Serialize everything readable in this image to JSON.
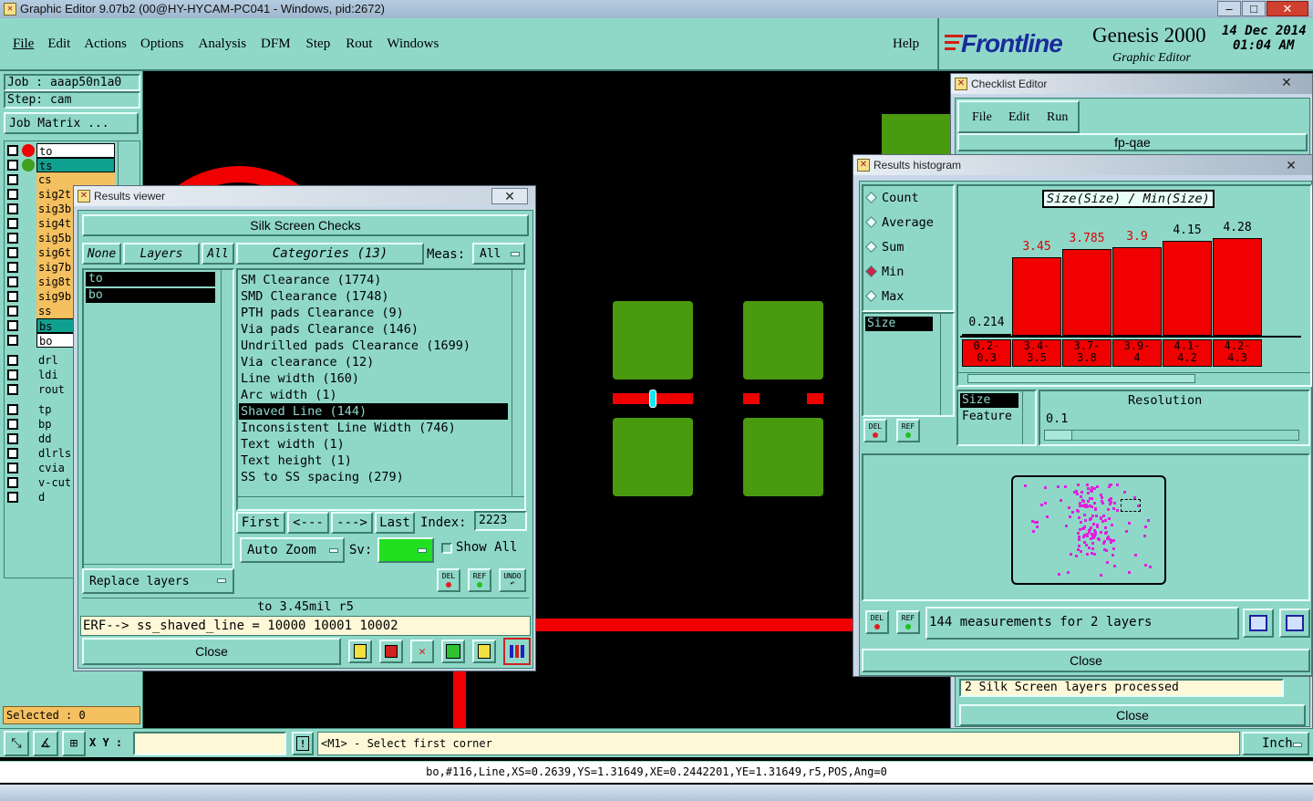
{
  "window": {
    "title": "Graphic Editor 9.07b2 (00@HY-HYCAM-PC041 - Windows, pid:2672)",
    "controls": [
      "–",
      "□",
      "✕"
    ]
  },
  "menu": {
    "items": [
      "File",
      "Edit",
      "Actions",
      "Options",
      "Analysis",
      "DFM",
      "Step",
      "Rout",
      "Windows"
    ],
    "help": "Help"
  },
  "brand": {
    "logo": "Frontline",
    "product": "Genesis 2000",
    "subtitle": "Graphic Editor",
    "date": "14 Dec 2014",
    "time": "01:04 AM"
  },
  "job": {
    "job_label": "Job : aaap50n1a0",
    "step_label": "Step: cam",
    "matrix_button": "Job Matrix ..."
  },
  "layers": [
    {
      "name": "to",
      "style": "white"
    },
    {
      "name": "ts",
      "style": "teal"
    },
    {
      "name": "cs",
      "style": "orange"
    },
    {
      "name": "sig2t",
      "style": "orange"
    },
    {
      "name": "sig3b",
      "style": "orange"
    },
    {
      "name": "sig4t",
      "style": "orange"
    },
    {
      "name": "sig5b",
      "style": "orange"
    },
    {
      "name": "sig6t",
      "style": "orange"
    },
    {
      "name": "sig7b",
      "style": "orange"
    },
    {
      "name": "sig8t",
      "style": "orange"
    },
    {
      "name": "sig9b",
      "style": "orange"
    },
    {
      "name": "ss",
      "style": "orange"
    },
    {
      "name": "bs",
      "style": "teal"
    },
    {
      "name": "bo",
      "style": "white"
    },
    {
      "name": "drl",
      "style": "grey"
    },
    {
      "name": "ldi",
      "style": "grey"
    },
    {
      "name": "rout",
      "style": "grey"
    },
    {
      "name": "tp",
      "style": "grey"
    },
    {
      "name": "bp",
      "style": "grey"
    },
    {
      "name": "dd",
      "style": "grey"
    },
    {
      "name": "dlrls",
      "style": "grey"
    },
    {
      "name": "cvia",
      "style": "grey"
    },
    {
      "name": "v-cut",
      "style": "grey"
    },
    {
      "name": "d",
      "style": "grey"
    }
  ],
  "selected": "Selected : 0",
  "bottom": {
    "xy_label": "X Y :",
    "prompt": "<M1> - Select first corner",
    "units": "Inch",
    "status": "bo,#116,Line,XS=0.2639,YS=1.31649,XE=0.2442201,YE=1.31649,r5,POS,Ang=0"
  },
  "results_viewer": {
    "title": "Results viewer",
    "header": "Silk Screen Checks",
    "none_btn": "None",
    "layers_btn": "Layers",
    "all_btn": "All",
    "categories_label": "Categories (13)",
    "meas_label": "Meas:",
    "meas_value": "All",
    "layers_list": [
      "to",
      "bo"
    ],
    "categories": [
      "SM Clearance (1774)",
      "SMD Clearance (1748)",
      "PTH pads Clearance (9)",
      "Via pads Clearance (146)",
      "Undrilled pads Clearance (1699)",
      "Via clearance (12)",
      "Line width (160)",
      "Arc width (1)",
      "Shaved Line (144)",
      "Inconsistent Line Width (746)",
      "Text width (1)",
      "Text height (1)",
      "SS to SS spacing (279)"
    ],
    "selected_category": "Shaved Line (144)",
    "first": "First",
    "prev": "<---",
    "next": "--->",
    "last": "Last",
    "index_label": "Index:",
    "index_value": "2223",
    "auto_zoom": "Auto Zoom",
    "sv_label": "Sv:",
    "show_all": "Show All",
    "replace_layers": "Replace layers",
    "del": "DEL",
    "ref": "REF",
    "undo": "UNDO",
    "range": "to 3.45mil   r5",
    "erf": "ERF--> ss_shaved_line = 10000 10001 10002",
    "close": "Close"
  },
  "checklist": {
    "title": "Checklist Editor",
    "menu": [
      "File",
      "Edit",
      "Run"
    ],
    "name": "fp-qae",
    "status": "2 Silk Screen layers processed",
    "close": "Close"
  },
  "histogram": {
    "title": "Results histogram",
    "modes": [
      "Count",
      "Average",
      "Sum",
      "Min",
      "Max"
    ],
    "selected_mode": "Min",
    "chart_title": "Size(Size) / Min(Size)",
    "field_list": [
      "Size"
    ],
    "field_list2": [
      "Size",
      "Feature"
    ],
    "resolution_label": "Resolution",
    "resolution_value": "0.1",
    "del": "DEL",
    "ref": "REF",
    "summary": "144 measurements for 2 layers",
    "close": "Close"
  },
  "chart_data": {
    "type": "bar",
    "title": "Size(Size) / Min(Size)",
    "categories": [
      "0.2-0.3",
      "3.4-3.5",
      "3.7-3.8",
      "3.9-4",
      "4.1-4.2",
      "4.2-4.3"
    ],
    "category_lines": [
      [
        "0.2-",
        "0.3"
      ],
      [
        "3.4-",
        "3.5"
      ],
      [
        "3.7-",
        "3.8"
      ],
      [
        "3.9-",
        "4"
      ],
      [
        "4.1-",
        "4.2"
      ],
      [
        "4.2-",
        "4.3"
      ]
    ],
    "value_labels": [
      "0.214",
      "3.45",
      "3.785",
      "3.9",
      "4.15",
      "4.28"
    ],
    "values": [
      0.214,
      3.45,
      3.785,
      3.9,
      4.15,
      4.28
    ],
    "ylim": [
      0,
      4.4
    ],
    "colors": {
      "bar": "#f00000",
      "label_high": "#e00000",
      "label_low": "#000000"
    }
  }
}
